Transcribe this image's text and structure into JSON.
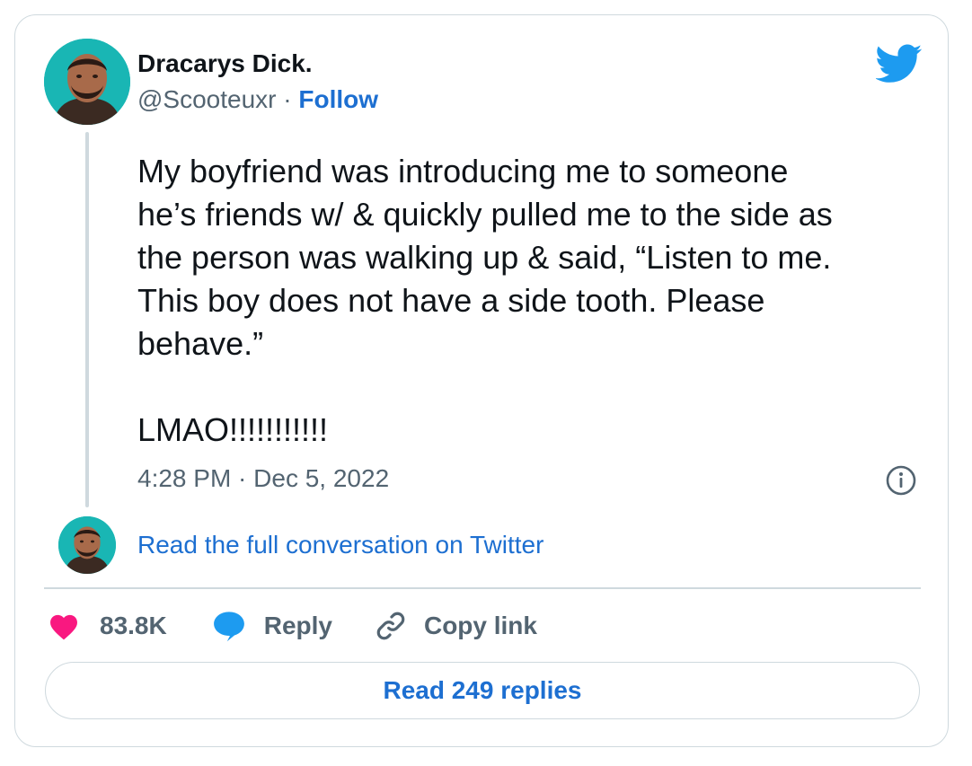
{
  "author": {
    "name": "Dracarys Dick.",
    "handle": "@Scooteuxr",
    "separator": " · ",
    "follow_label": "Follow"
  },
  "tweet": {
    "text": "My boyfriend was introducing me to someone\nhe’s friends w/ & quickly pulled me to the side as\nthe person was walking up & said, “Listen to me.\nThis boy does not have a side tooth. Please\nbehave.”\n\nLMAO!!!!!!!!!!!",
    "timestamp": "4:28 PM · Dec 5, 2022"
  },
  "conversation_link": "Read the full conversation on Twitter",
  "actions": {
    "like_count": "83.8K",
    "reply_label": "Reply",
    "copy_link_label": "Copy link"
  },
  "read_replies_label": "Read 249 replies",
  "icons": {
    "logo": "twitter-bird-icon",
    "info": "info-circle-icon",
    "like": "heart-icon",
    "reply": "speech-bubble-icon",
    "copy": "link-icon"
  },
  "colors": {
    "accent": "#1d6fd1",
    "twitter_blue": "#1d9bf0",
    "like": "#f91880",
    "text_primary": "#0f1419",
    "text_secondary": "#536471",
    "border": "#cfd9de"
  }
}
